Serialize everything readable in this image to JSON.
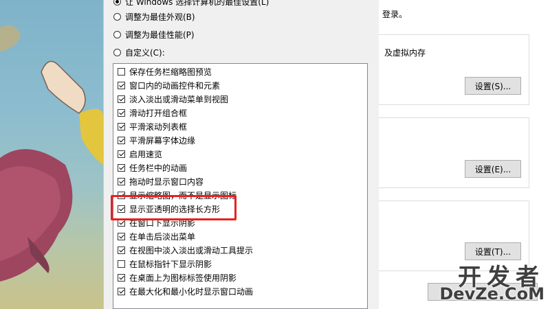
{
  "dialog": {
    "radio_options": [
      {
        "label": "让 Windows 选择计算机的最佳设置(L)",
        "checked": true
      },
      {
        "label": "调整为最佳外观(B)",
        "checked": false
      },
      {
        "label": "调整为最佳性能(P)",
        "checked": false
      },
      {
        "label": "自定义(C):",
        "checked": false
      }
    ],
    "effects": [
      {
        "label": "保存任务栏缩略图预览",
        "checked": false
      },
      {
        "label": "窗口内的动画控件和元素",
        "checked": true
      },
      {
        "label": "淡入淡出或滑动菜单到视图",
        "checked": true
      },
      {
        "label": "滑动打开组合框",
        "checked": true
      },
      {
        "label": "平滑滚动列表框",
        "checked": true
      },
      {
        "label": "平滑屏幕字体边缘",
        "checked": true
      },
      {
        "label": "启用速览",
        "checked": true
      },
      {
        "label": "任务栏中的动画",
        "checked": true
      },
      {
        "label": "拖动时显示窗口内容",
        "checked": true
      },
      {
        "label": "显示缩略图，而不是显示图标",
        "checked": true
      },
      {
        "label": "显示亚透明的选择长方形",
        "checked": true
      },
      {
        "label": "在窗口下显示阴影",
        "checked": true
      },
      {
        "label": "在单击后淡出菜单",
        "checked": true
      },
      {
        "label": "在视图中淡入淡出或滑动工具提示",
        "checked": true
      },
      {
        "label": "在鼠标指针下显示阴影",
        "checked": false
      },
      {
        "label": "在桌面上为图标标签使用阴影",
        "checked": true
      },
      {
        "label": "在最大化和最小化时显示窗口动画",
        "checked": true
      }
    ]
  },
  "right_panel": {
    "login_text": "登录。",
    "perf_text": "及虚拟内存",
    "btn_settings_s": "设置(S)...",
    "btn_settings_e": "设置(E)...",
    "btn_settings_t": "设置(T)..."
  },
  "watermark": {
    "line1": "开发者",
    "line2": "DevZe.CoM"
  },
  "colors": {
    "highlight": "#e8201f",
    "dialog_bg": "#f0f0f0"
  }
}
